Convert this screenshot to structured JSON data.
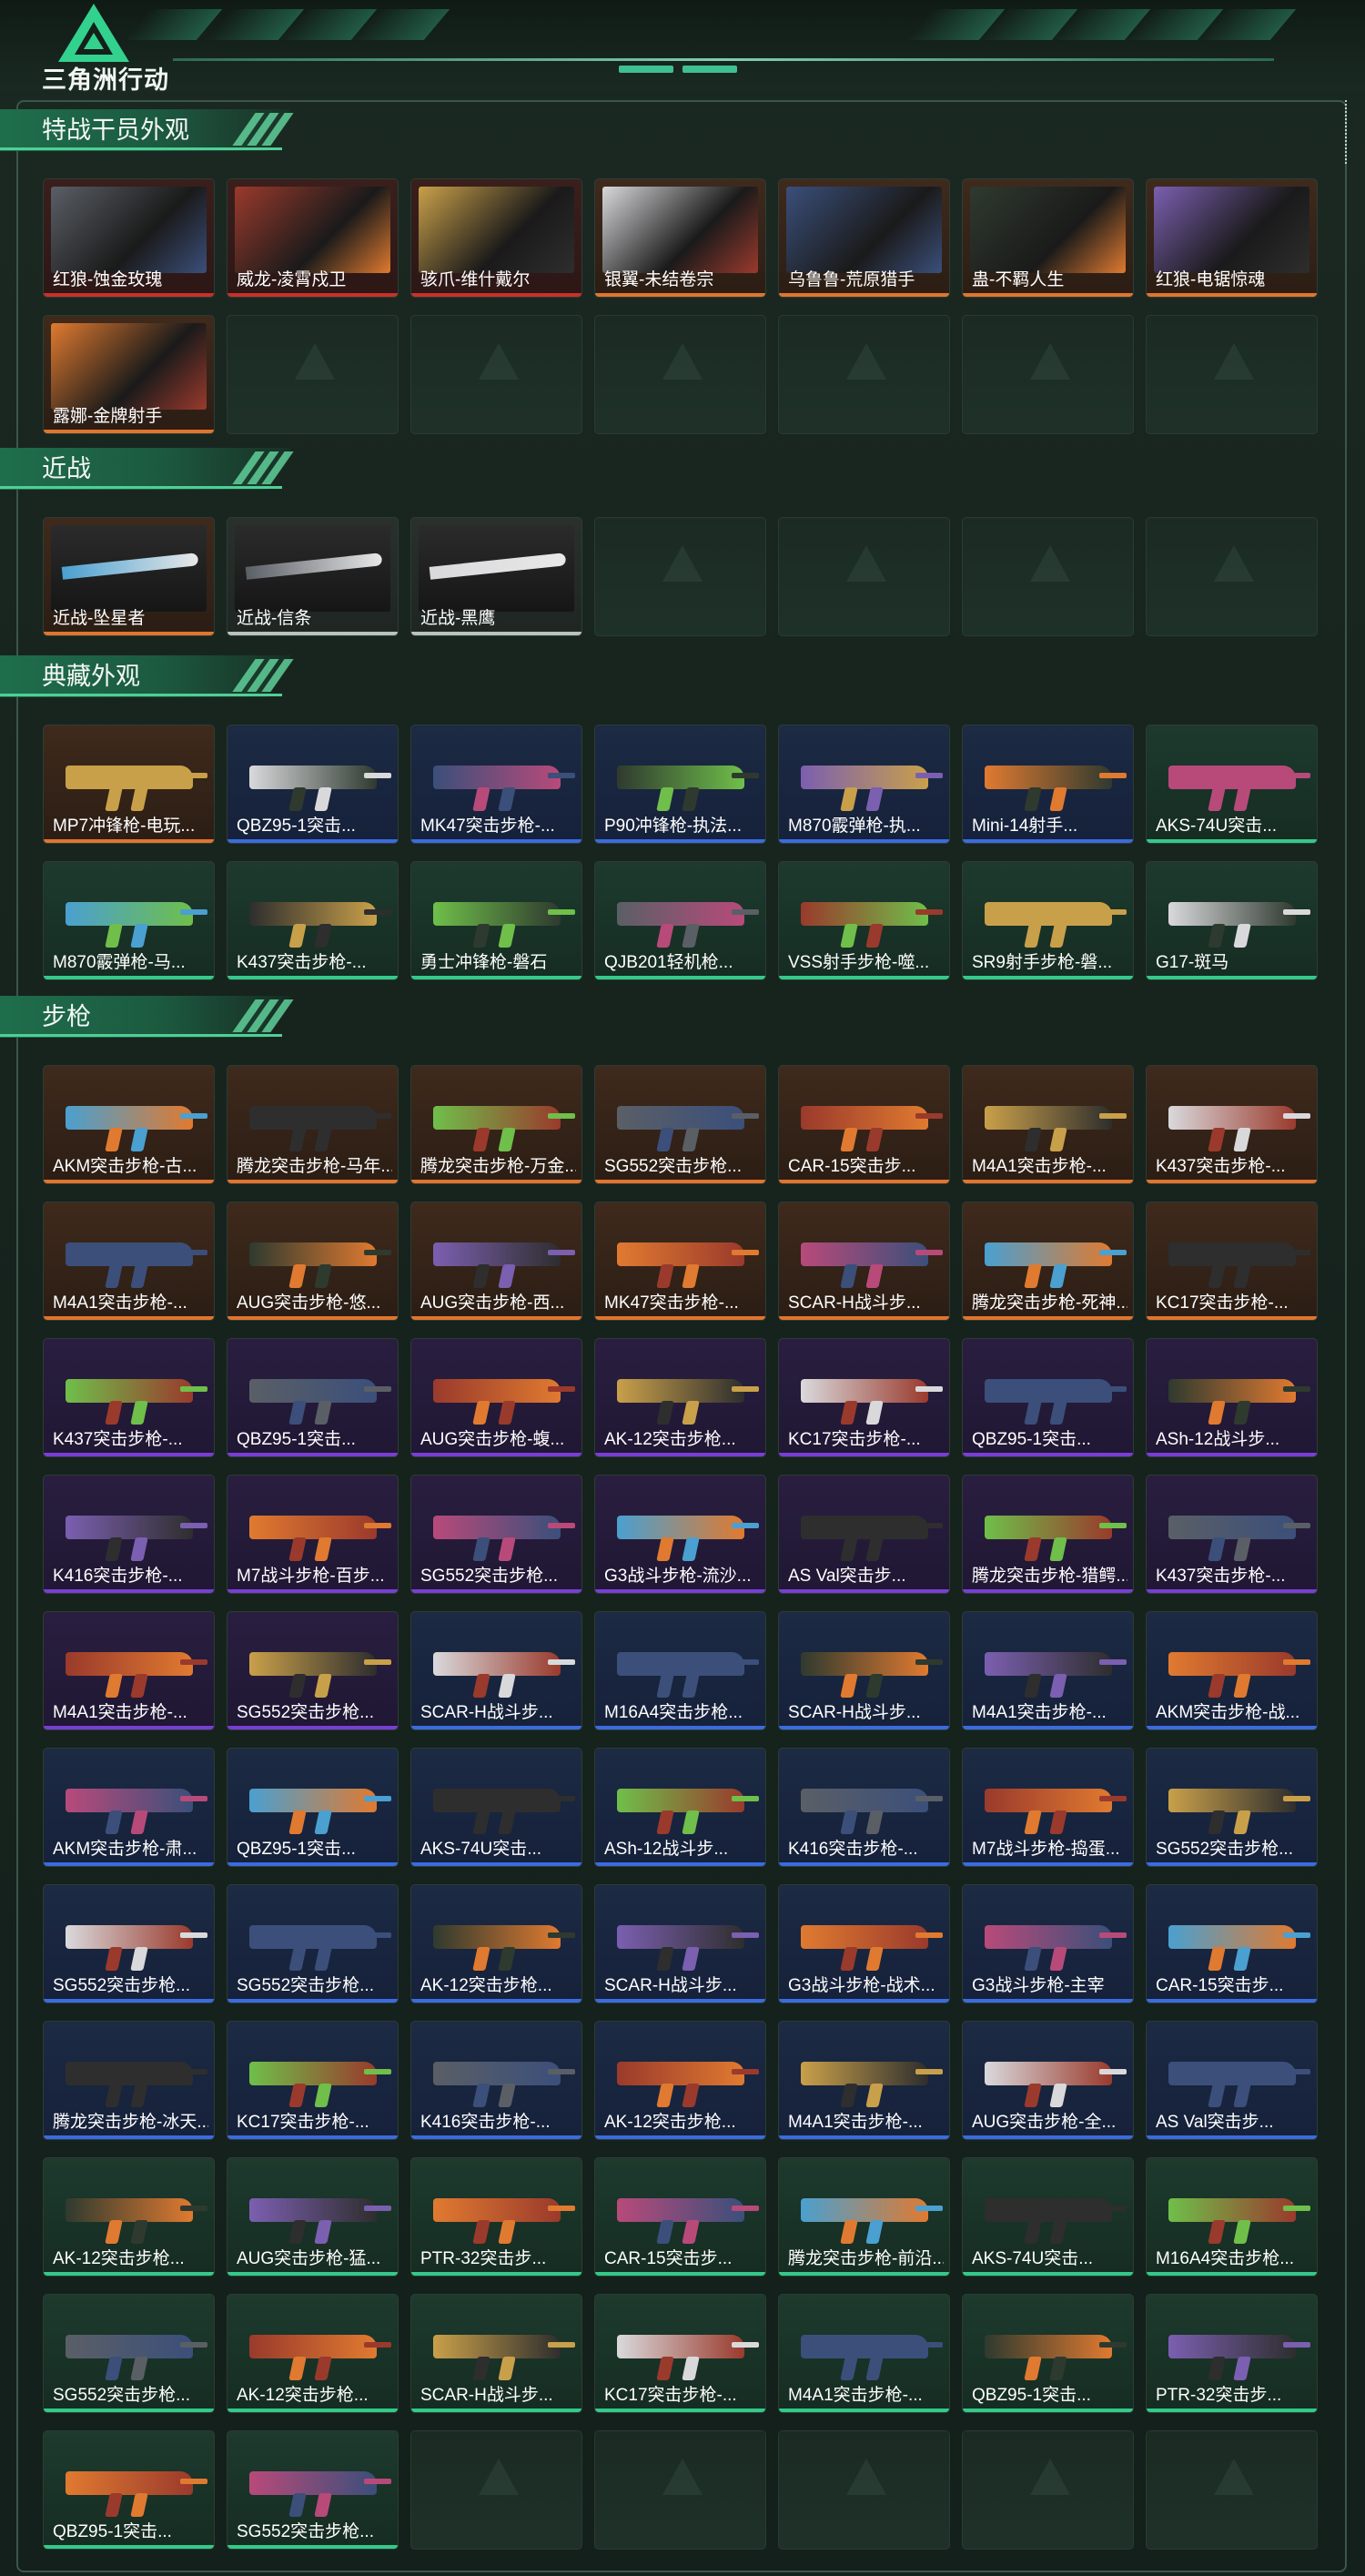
{
  "header": {
    "logo_text": "三角洲行动",
    "logo_icon": "delta-triangle-icon"
  },
  "colors": {
    "orange": "#e0752f",
    "blue": "#3b6be0",
    "purple": "#7a3ed6",
    "green": "#34c98a",
    "red": "#c8312a",
    "gray": "#b9c2be"
  },
  "sections": [
    {
      "title": "特战干员外观",
      "items": [
        {
          "label": "红狼-蚀金玫瑰",
          "rarity": "red"
        },
        {
          "label": "威龙-凌霄戍卫",
          "rarity": "red"
        },
        {
          "label": "骇爪-维什戴尔",
          "rarity": "red"
        },
        {
          "label": "银翼-未结卷宗",
          "rarity": "orange"
        },
        {
          "label": "乌鲁鲁-荒原猎手",
          "rarity": "orange"
        },
        {
          "label": "蛊-不羁人生",
          "rarity": "orange"
        },
        {
          "label": "红狼-电锯惊魂",
          "rarity": "orange"
        },
        {
          "label": "露娜-金牌射手",
          "rarity": "orange"
        },
        {
          "label": "",
          "rarity": "empty"
        },
        {
          "label": "",
          "rarity": "empty"
        },
        {
          "label": "",
          "rarity": "empty"
        },
        {
          "label": "",
          "rarity": "empty"
        },
        {
          "label": "",
          "rarity": "empty"
        },
        {
          "label": "",
          "rarity": "empty"
        }
      ]
    },
    {
      "title": "近战",
      "items": [
        {
          "label": "近战-坠星者",
          "rarity": "orange"
        },
        {
          "label": "近战-信条",
          "rarity": "gray"
        },
        {
          "label": "近战-黑鹰",
          "rarity": "gray"
        },
        {
          "label": "",
          "rarity": "empty"
        },
        {
          "label": "",
          "rarity": "empty"
        },
        {
          "label": "",
          "rarity": "empty"
        },
        {
          "label": "",
          "rarity": "empty"
        }
      ]
    },
    {
      "title": "典藏外观",
      "items": [
        {
          "label": "MP7冲锋枪-电玩...",
          "rarity": "orange"
        },
        {
          "label": "QBZ95-1突击...",
          "rarity": "blue"
        },
        {
          "label": "MK47突击步枪-...",
          "rarity": "blue"
        },
        {
          "label": "P90冲锋枪-执法...",
          "rarity": "blue"
        },
        {
          "label": "M870霰弹枪-执...",
          "rarity": "blue"
        },
        {
          "label": "Mini-14射手...",
          "rarity": "blue"
        },
        {
          "label": "AKS-74U突击...",
          "rarity": "green"
        },
        {
          "label": "M870霰弹枪-马...",
          "rarity": "green"
        },
        {
          "label": "K437突击步枪-...",
          "rarity": "green"
        },
        {
          "label": "勇士冲锋枪-磐石",
          "rarity": "green"
        },
        {
          "label": "QJB201轻机枪...",
          "rarity": "green"
        },
        {
          "label": "VSS射手步枪-噬...",
          "rarity": "green"
        },
        {
          "label": "SR9射手步枪-磐...",
          "rarity": "green"
        },
        {
          "label": "G17-斑马",
          "rarity": "green"
        }
      ]
    },
    {
      "title": "步枪",
      "items": [
        {
          "label": "AKM突击步枪-古...",
          "rarity": "orange"
        },
        {
          "label": "腾龙突击步枪-马年...",
          "rarity": "orange"
        },
        {
          "label": "腾龙突击步枪-万金...",
          "rarity": "orange"
        },
        {
          "label": "SG552突击步枪...",
          "rarity": "orange"
        },
        {
          "label": "CAR-15突击步...",
          "rarity": "orange"
        },
        {
          "label": "M4A1突击步枪-...",
          "rarity": "orange"
        },
        {
          "label": "K437突击步枪-...",
          "rarity": "orange"
        },
        {
          "label": "M4A1突击步枪-...",
          "rarity": "orange"
        },
        {
          "label": "AUG突击步枪-悠...",
          "rarity": "orange"
        },
        {
          "label": "AUG突击步枪-西...",
          "rarity": "orange"
        },
        {
          "label": "MK47突击步枪-...",
          "rarity": "orange"
        },
        {
          "label": "SCAR-H战斗步...",
          "rarity": "orange"
        },
        {
          "label": "腾龙突击步枪-死神...",
          "rarity": "orange"
        },
        {
          "label": "KC17突击步枪-...",
          "rarity": "orange"
        },
        {
          "label": "K437突击步枪-...",
          "rarity": "purple"
        },
        {
          "label": "QBZ95-1突击...",
          "rarity": "purple"
        },
        {
          "label": "AUG突击步枪-蝮...",
          "rarity": "purple"
        },
        {
          "label": "AK-12突击步枪...",
          "rarity": "purple"
        },
        {
          "label": "KC17突击步枪-...",
          "rarity": "purple"
        },
        {
          "label": "QBZ95-1突击...",
          "rarity": "purple"
        },
        {
          "label": "ASh-12战斗步...",
          "rarity": "purple"
        },
        {
          "label": "K416突击步枪-...",
          "rarity": "purple"
        },
        {
          "label": "M7战斗步枪-百步...",
          "rarity": "purple"
        },
        {
          "label": "SG552突击步枪...",
          "rarity": "purple"
        },
        {
          "label": "G3战斗步枪-流沙...",
          "rarity": "purple"
        },
        {
          "label": "AS Val突击步...",
          "rarity": "purple"
        },
        {
          "label": "腾龙突击步枪-猎鳄...",
          "rarity": "purple"
        },
        {
          "label": "K437突击步枪-...",
          "rarity": "purple"
        },
        {
          "label": "M4A1突击步枪-...",
          "rarity": "purple"
        },
        {
          "label": "SG552突击步枪...",
          "rarity": "purple"
        },
        {
          "label": "SCAR-H战斗步...",
          "rarity": "blue"
        },
        {
          "label": "M16A4突击步枪...",
          "rarity": "blue"
        },
        {
          "label": "SCAR-H战斗步...",
          "rarity": "blue"
        },
        {
          "label": "M4A1突击步枪-...",
          "rarity": "blue"
        },
        {
          "label": "AKM突击步枪-战...",
          "rarity": "blue"
        },
        {
          "label": "AKM突击步枪-肃...",
          "rarity": "blue"
        },
        {
          "label": "QBZ95-1突击...",
          "rarity": "blue"
        },
        {
          "label": "AKS-74U突击...",
          "rarity": "blue"
        },
        {
          "label": "ASh-12战斗步...",
          "rarity": "blue"
        },
        {
          "label": "K416突击步枪-...",
          "rarity": "blue"
        },
        {
          "label": "M7战斗步枪-捣蛋...",
          "rarity": "blue"
        },
        {
          "label": "SG552突击步枪...",
          "rarity": "blue"
        },
        {
          "label": "SG552突击步枪...",
          "rarity": "blue"
        },
        {
          "label": "SG552突击步枪...",
          "rarity": "blue"
        },
        {
          "label": "AK-12突击步枪...",
          "rarity": "blue"
        },
        {
          "label": "SCAR-H战斗步...",
          "rarity": "blue"
        },
        {
          "label": "G3战斗步枪-战术...",
          "rarity": "blue"
        },
        {
          "label": "G3战斗步枪-主宰",
          "rarity": "blue"
        },
        {
          "label": "CAR-15突击步...",
          "rarity": "blue"
        },
        {
          "label": "腾龙突击步枪-冰天...",
          "rarity": "blue"
        },
        {
          "label": "KC17突击步枪-...",
          "rarity": "blue"
        },
        {
          "label": "K416突击步枪-...",
          "rarity": "blue"
        },
        {
          "label": "AK-12突击步枪...",
          "rarity": "blue"
        },
        {
          "label": "M4A1突击步枪-...",
          "rarity": "blue"
        },
        {
          "label": "AUG突击步枪-全...",
          "rarity": "blue"
        },
        {
          "label": "AS Val突击步...",
          "rarity": "blue"
        },
        {
          "label": "AK-12突击步枪...",
          "rarity": "green"
        },
        {
          "label": "AUG突击步枪-猛...",
          "rarity": "green"
        },
        {
          "label": "PTR-32突击步...",
          "rarity": "green"
        },
        {
          "label": "CAR-15突击步...",
          "rarity": "green"
        },
        {
          "label": "腾龙突击步枪-前沿...",
          "rarity": "green"
        },
        {
          "label": "AKS-74U突击...",
          "rarity": "green"
        },
        {
          "label": "M16A4突击步枪...",
          "rarity": "green"
        },
        {
          "label": "SG552突击步枪...",
          "rarity": "green"
        },
        {
          "label": "AK-12突击步枪...",
          "rarity": "green"
        },
        {
          "label": "SCAR-H战斗步...",
          "rarity": "green"
        },
        {
          "label": "KC17突击步枪-...",
          "rarity": "green"
        },
        {
          "label": "M4A1突击步枪-...",
          "rarity": "green"
        },
        {
          "label": "QBZ95-1突击...",
          "rarity": "green"
        },
        {
          "label": "PTR-32突击步...",
          "rarity": "green"
        },
        {
          "label": "QBZ95-1突击...",
          "rarity": "green"
        },
        {
          "label": "SG552突击步枪...",
          "rarity": "green"
        },
        {
          "label": "",
          "rarity": "empty"
        },
        {
          "label": "",
          "rarity": "empty"
        },
        {
          "label": "",
          "rarity": "empty"
        },
        {
          "label": "",
          "rarity": "empty"
        },
        {
          "label": "",
          "rarity": "empty"
        }
      ]
    }
  ]
}
